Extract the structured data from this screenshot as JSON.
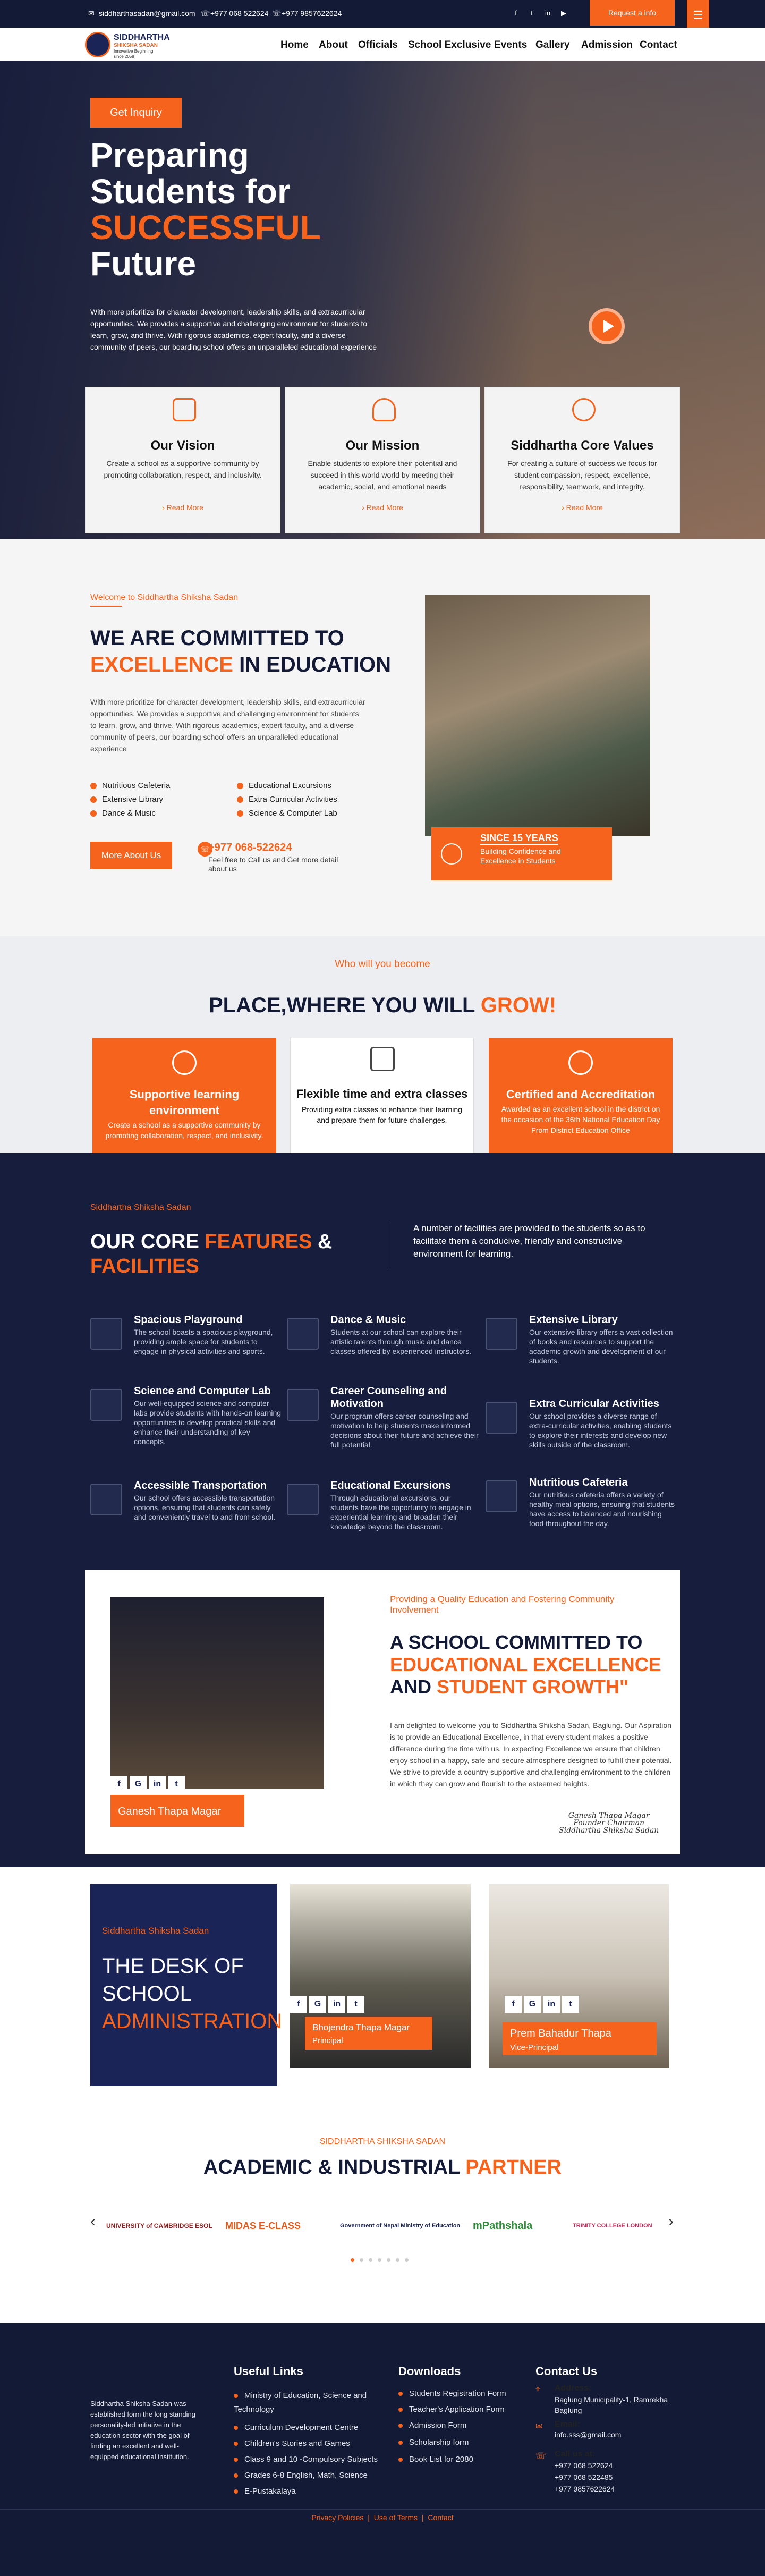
{
  "topbar": {
    "email": "siddharthasadan@gmail.com",
    "phone1": "+977 068 522624",
    "phone2": "+977 9857622624",
    "social": [
      "f",
      "t",
      "in",
      "▶"
    ],
    "request_btn": "Request a info",
    "menu_icon": "☰"
  },
  "nav": {
    "logo_title": "SIDDHARTHA",
    "logo_sub1": "SHIKSHA SADAN",
    "logo_sub2": "Innovative Beginning",
    "logo_sub3": "since 2058",
    "links": [
      "Home",
      "About",
      "Officials",
      "School Exclusive",
      "Events",
      "Gallery",
      "Admission",
      "Contact"
    ]
  },
  "hero": {
    "inquiry_btn": "Get Inquiry",
    "title_l1": "Preparing",
    "title_l2": "Students for",
    "title_l3": "SUCCESSFUL",
    "title_l4": "Future",
    "desc": "With more prioritize for character development, leadership skills, and extracurricular opportunities. We provides a supportive and challenging environment for students to learn, grow, and thrive. With rigorous academics, expert faculty, and a diverse community of peers, our boarding school offers an unparalleled educational experience"
  },
  "vision_cards": [
    {
      "title": "Our Vision",
      "desc": "Create a school as a supportive community by promoting collaboration, respect, and inclusivity.",
      "link": "Read More"
    },
    {
      "title": "Our Mission",
      "desc": "Enable students to explore their potential and succeed in this world world by meeting their academic, social, and emotional needs",
      "link": "Read More"
    },
    {
      "title": "Siddhartha Core Values",
      "desc": "For creating a culture of success we focus for student compassion, respect, excellence, responsibility, teamwork, and integrity.",
      "link": "Read More"
    }
  ],
  "committed": {
    "welcome": "Welcome to Siddhartha Shiksha Sadan",
    "title_l1": "WE ARE COMMITTED TO",
    "title_em": "EXCELLENCE",
    "title_l2": "IN EDUCATION",
    "desc": "With more prioritize for character development, leadership skills, and extracurricular opportunities. We provides a supportive and challenging environment for students to learn, grow, and thrive. With rigorous academics, expert faculty, and a diverse community of peers, our boarding school offers an unparalleled educational experience",
    "facilities_left": [
      "Nutritious Cafeteria",
      "Extensive Library",
      "Dance & Music"
    ],
    "facilities_right": [
      "Educational Excursions",
      "Extra Curricular Activities",
      "Science & Computer Lab"
    ],
    "more_btn": "More About Us",
    "phone": "+977 068-522624",
    "phone_sub": "Feel free to Call us and Get more detail about us",
    "badge_title": "SINCE 15 YEARS",
    "badge_sub": "Building Confidence and Excellence in Students"
  },
  "grow": {
    "kicker": "Who will you become",
    "title": "PLACE,WHERE YOU WILL",
    "title_em": "GROW!",
    "cards": [
      {
        "title": "Supportive learning environment",
        "desc": "Create a school as a supportive community by promoting collaboration, respect, and inclusivity."
      },
      {
        "title": "Flexible time and extra classes",
        "desc": "Providing extra classes to enhance their learning and prepare them for future challenges."
      },
      {
        "title": "Certified and Accreditation",
        "desc": "Awarded as an excellent school in the district on the occasion of the 36th National Education Day From District Education Office"
      }
    ]
  },
  "features": {
    "kicker": "Siddhartha Shiksha Sadan",
    "title_l1": "OUR CORE",
    "title_em1": "FEATURES",
    "title_amp": "&",
    "title_em2": "FACILITIES",
    "intro": "A number of facilities are provided to the students so as to facilitate them a conducive, friendly and constructive environment for learning.",
    "items": [
      {
        "title": "Spacious Playground",
        "desc": "The school boasts a spacious playground, providing ample space for students to engage in physical activities and sports."
      },
      {
        "title": "Dance & Music",
        "desc": "Students at our school can explore their artistic talents through music and dance classes offered by experienced instructors."
      },
      {
        "title": "Extensive Library",
        "desc": "Our extensive library offers a vast collection of books and resources to support the academic growth and development of our students."
      },
      {
        "title": "Science and Computer Lab",
        "desc": "Our well-equipped science and computer labs provide students with hands-on learning opportunities to develop practical skills and enhance their understanding of key concepts."
      },
      {
        "title": "Career Counseling and Motivation",
        "desc": "Our program offers career counseling and motivation to help students make informed decisions about their future and achieve their full potential."
      },
      {
        "title": "Extra Curricular Activities",
        "desc": "Our school provides a diverse range of extra-curricular activities, enabling students to explore their interests and develop new skills outside of the classroom."
      },
      {
        "title": "Accessible Transportation",
        "desc": "Our school offers accessible transportation options, ensuring that students can safely and conveniently travel to and from school."
      },
      {
        "title": "Educational Excursions",
        "desc": "Through educational excursions, our students have the opportunity to engage in experiential learning and broaden their knowledge beyond the classroom."
      },
      {
        "title": "Nutritious Cafeteria",
        "desc": "Our nutritious cafeteria offers a variety of healthy meal options, ensuring that students have access to balanced and nourishing food throughout the day."
      }
    ]
  },
  "message": {
    "person": "Ganesh Thapa Magar",
    "kicker": "Providing a Quality Education and Fostering Community Involvement",
    "title_l1": "A SCHOOL COMMITTED TO",
    "title_em1": "EDUCATIONAL EXCELLENCE",
    "title_and": "AND",
    "title_em2": "STUDENT GROWTH\"",
    "body": "I am delighted to welcome you to Siddhartha Shiksha Sadan, Baglung. Our Aspiration is to provide an Educational Excellence, in that every student makes a positive difference during the time with us. In expecting Excellence we ensure that children enjoy school in a happy, safe and secure atmosphere designed to fulfill their potential. We strive to provide a country supportive and challenging environment to the children in which they can grow and flourish to the esteemed heights.",
    "sig_l1": "Ganesh Thapa Magar",
    "sig_l2": "Founder Chairman",
    "sig_l3": "Siddhartha Shiksha Sadan",
    "social": [
      "f",
      "G",
      "in",
      "t"
    ]
  },
  "admin": {
    "kicker": "Siddhartha Shiksha Sadan",
    "title_l1": "THE DESK OF",
    "title_l2": "SCHOOL",
    "title_em": "ADMINISTRATION",
    "people": [
      {
        "name": "Bhojendra Thapa Magar",
        "role": "Principal"
      },
      {
        "name": "Prem Bahadur Thapa",
        "role": "Vice-Principal"
      }
    ],
    "social": [
      "f",
      "G",
      "in",
      "t"
    ]
  },
  "partners": {
    "kicker": "SIDDHARTHA SHIKSHA SADAN",
    "title": "ACADEMIC & INDUSTRIAL",
    "title_em": "PARTNER",
    "logos": [
      "UNIVERSITY of CAMBRIDGE ESOL",
      "MIDAS E-CLASS",
      "Government of Nepal Ministry of Education",
      "mPathshala",
      "TRINITY COLLEGE LONDON"
    ],
    "prev": "‹",
    "next": "›"
  },
  "footer": {
    "about": "Siddhartha Shiksha Sadan was established form the long standing personality-led initiative in the education sector with the goal of finding an excellent and well-equipped educational institution.",
    "useful_title": "Useful Links",
    "useful_links": [
      "Ministry of Education, Science and Technology",
      "Curriculum Development Centre",
      "Children's Stories and Games",
      "Class 9 and 10 -Compulsory Subjects",
      "Grades 6-8 English, Math, Science",
      "E-Pustakalaya"
    ],
    "downloads_title": "Downloads",
    "downloads": [
      "Students Registration Form",
      "Teacher's Application Form",
      "Admission Form",
      "Scholarship form",
      "Book List for 2080"
    ],
    "contact_title": "Contact Us",
    "address_label": "Address:",
    "address": "Baglung Municipality-1, Ramrekha Baglung",
    "email_label": "Email:",
    "email": "info.sss@gmail.com",
    "call_label": "Call us at:",
    "phones": [
      "+977 068 522624",
      "+977 068 522485",
      "+977 9857622624"
    ],
    "bottom_links": [
      "Privacy Policies",
      "Use of Terms",
      "Contact"
    ],
    "sep": "|"
  },
  "colors": {
    "accent": "#f5631d",
    "navy": "#161d3d"
  }
}
